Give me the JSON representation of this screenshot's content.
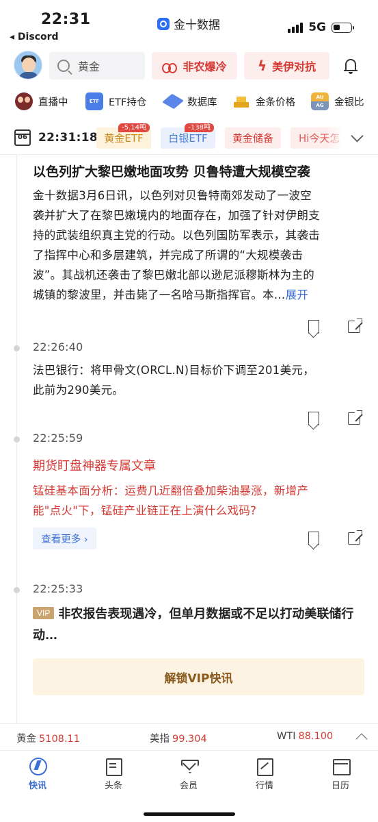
{
  "status_bar": {
    "time": "22:31",
    "back_label": "◂ Discord",
    "app_name": "金十数据",
    "network": "5G"
  },
  "header": {
    "search_placeholder": "黄金",
    "pill_nfp": "非农爆冷",
    "pill_us_iran": "美伊对抗"
  },
  "quick_nav": [
    {
      "label": "直播中",
      "icon": "live-avatar-icon"
    },
    {
      "label": "ETF持仓",
      "icon": "etf-icon"
    },
    {
      "label": "数据库",
      "icon": "database-icon"
    },
    {
      "label": "金条价格",
      "icon": "gold-bar-icon"
    },
    {
      "label": "金银比",
      "icon": "au-ag-icon"
    }
  ],
  "qn_icon_text": {
    "etf": "ETF",
    "au": "AU",
    "ag": "AG"
  },
  "filter": {
    "calendar_day": "06",
    "time": "22:31:18",
    "tags": [
      {
        "label": "黄金ETF",
        "badge": "-5.14吨"
      },
      {
        "label": "白银ETF",
        "badge": "-138吨"
      },
      {
        "label": "黄金储备",
        "badge": ""
      },
      {
        "label": "Hi今天怎",
        "badge": ""
      }
    ]
  },
  "feed": {
    "item1": {
      "headline": "以色列扩大黎巴嫩地面攻势 贝鲁特遭大规模空袭",
      "body_lines": [
        "金十数据3月6日讯，以色列对贝鲁特南郊发动了一波空",
        "袭并扩大了在黎巴嫩境内的地面存在，加强了针对伊朗支",
        "持的武装组织真主党的行动。以色列国防军表示，其袭击",
        "了指挥中心和多层建筑，并完成了所谓的“大规模袭击",
        "波”。其战机还袭击了黎巴嫩北部以逊尼派穆斯林为主的",
        "城镇的黎波里，并击毙了一名哈马斯指挥官。本…"
      ],
      "expand": "展开"
    },
    "item2": {
      "time": "22:26:40",
      "body_lines": [
        "法巴银行：将甲骨文(ORCL.N)目标价下调至201美元，",
        "此前为290美元。"
      ]
    },
    "item3": {
      "time": "22:25:59",
      "headline": "期货盯盘神器专属文章",
      "body_lines": [
        "锰硅基本面分析：运费几近翻倍叠加柴油暴涨，新增产",
        "能\"点火\"下，锰硅产业链正在上演什么戏码?"
      ],
      "more": "查看更多 ›"
    },
    "item4": {
      "time": "22:25:33",
      "vip_badge": "VIP",
      "headline": "非农报告表现遇冷，但单月数据或不足以打动美联储行动…",
      "unlock": "解锁VIP快讯"
    }
  },
  "ticker": [
    {
      "name": "黄金",
      "value": "5108.11"
    },
    {
      "name": "美指",
      "value": "99.304"
    },
    {
      "name": "WTI",
      "value": "88.100"
    }
  ],
  "tabs": [
    {
      "label": "快讯",
      "icon": "flash-icon",
      "active": true
    },
    {
      "label": "头条",
      "icon": "news-icon",
      "active": false
    },
    {
      "label": "会员",
      "icon": "vip-diamond-icon",
      "active": false
    },
    {
      "label": "行情",
      "icon": "chart-icon",
      "active": false
    },
    {
      "label": "日历",
      "icon": "calendar-icon",
      "active": false
    }
  ],
  "colors": {
    "accent_red": "#d63a34",
    "accent_blue": "#3b6fd6",
    "gold": "#c8891a"
  }
}
